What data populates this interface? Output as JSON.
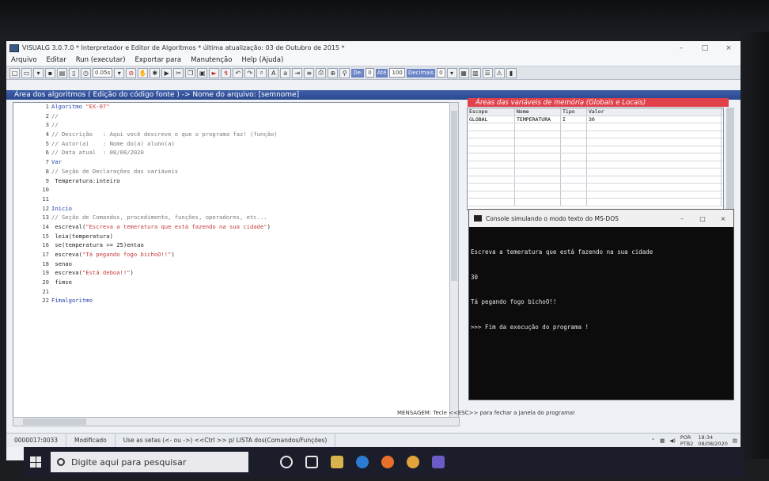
{
  "window": {
    "title": "VISUALG 3.0.7.0 * Interpretador e Editor de Algoritmos * última atualização: 03 de Outubro de 2015 *",
    "minimize": "–",
    "maximize": "□",
    "close": "×"
  },
  "menu": [
    "Arquivo",
    "Editar",
    "Run (executar)",
    "Exportar para",
    "Manutenção",
    "Help (Ajuda)"
  ],
  "toolbar": {
    "timer_value": "0.05s",
    "de_label": "De:",
    "de_value": "0",
    "ate_label": "Até",
    "ate_value": "100",
    "decimais_label": "Decimais",
    "decimais_value": "0"
  },
  "area_header": "Área dos algoritmos ( Edição do código fonte ) -> Nome do arquivo: [semnome]",
  "code_lines": [
    {
      "n": "1",
      "t": "Algoritmo \"EX-07\""
    },
    {
      "n": "2",
      "t": "//"
    },
    {
      "n": "3",
      "t": "//"
    },
    {
      "n": "4",
      "t": "// Descrição   : Aqui você descreve o que o programa faz! (função)"
    },
    {
      "n": "5",
      "t": "// Autor(a)    : Nome do(a) aluno(a)"
    },
    {
      "n": "6",
      "t": "// Data atual  : 08/08/2020"
    },
    {
      "n": "7",
      "t": "Var"
    },
    {
      "n": "8",
      "t": "// Seção de Declarações das variáveis"
    },
    {
      "n": "9",
      "t": " Temperatura:inteiro"
    },
    {
      "n": "10",
      "t": ""
    },
    {
      "n": "11",
      "t": ""
    },
    {
      "n": "12",
      "t": "Inicio"
    },
    {
      "n": "13",
      "t": "// Seção de Comandos, procedimento, funções, operadores, etc..."
    },
    {
      "n": "14",
      "t": " escreval(\"Escreva a temeratura que está fazendo na sua cidade\")"
    },
    {
      "n": "15",
      "t": " leia(temperatura)"
    },
    {
      "n": "16",
      "t": " se(temperatura >= 25)entao"
    },
    {
      "n": "17",
      "t": " escreva(\"Tá pegando fogo bichoO!!\")"
    },
    {
      "n": "18",
      "t": " senao"
    },
    {
      "n": "19",
      "t": " escreva(\"Está deboa!!\")"
    },
    {
      "n": "20",
      "t": " fimse"
    },
    {
      "n": "21",
      "t": ""
    },
    {
      "n": "22",
      "t": "Fimalgoritmo"
    }
  ],
  "vars": {
    "title": "Áreas das variáveis de memória (Globais e Locais)",
    "headers": [
      "Escopo",
      "Nome",
      "Tipo",
      "Valor"
    ],
    "rows": [
      [
        "GLOBAL",
        "TEMPERATURA",
        "I",
        "30"
      ]
    ]
  },
  "console": {
    "title": "Console simulando o modo texto do MS-DOS",
    "lines": [
      "Escreva a temeratura que está fazendo na sua cidade",
      "30",
      "Tá pegando fogo bichoO!!",
      ">>> Fim da execução do programa !"
    ]
  },
  "message": "MENSAGEM: Tecle <<ESC>> para fechar a janela do programa!",
  "status": {
    "position": "0000017:0033",
    "state": "Modificado",
    "hint": "Use as setas (<- ou ->) <<Ctrl >> p/ LISTA dos(Comandos/Funções)"
  },
  "tray": {
    "lang": "POR",
    "layout": "PTB2",
    "time": "18:34",
    "date": "08/08/2020"
  },
  "taskbar": {
    "search_placeholder": "Digite aqui para pesquisar"
  }
}
